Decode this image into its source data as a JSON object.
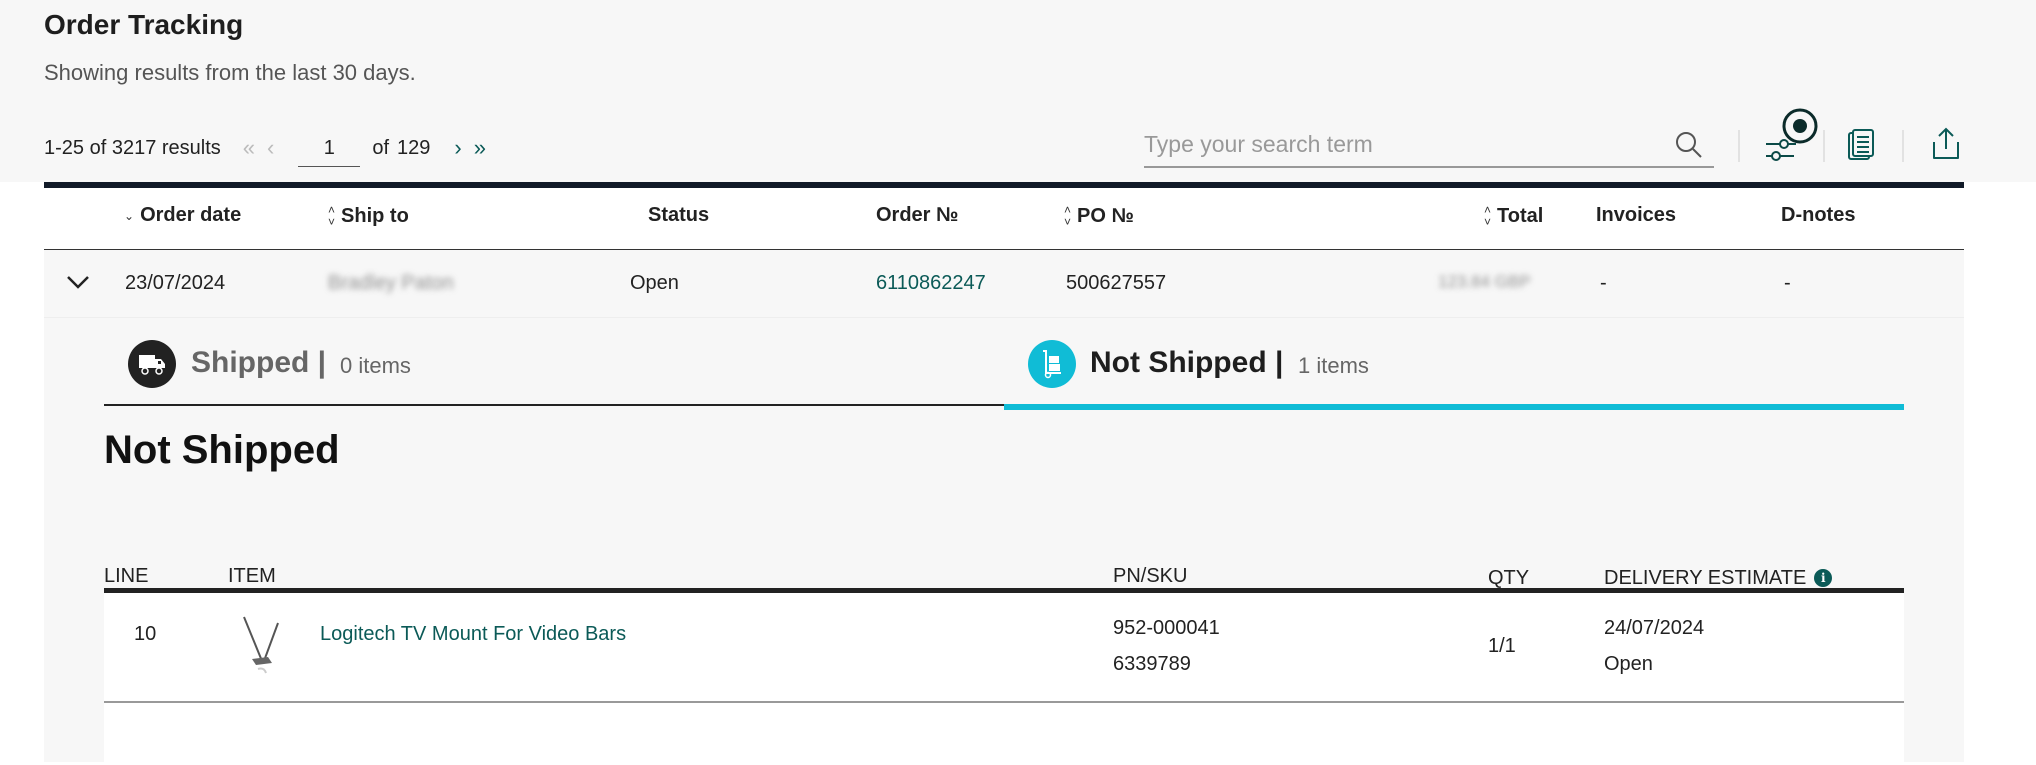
{
  "page": {
    "title": "Order Tracking",
    "subtitle": "Showing results from the last 30 days."
  },
  "pagination": {
    "results_text": "1-25 of 3217 results",
    "first_icon": "«",
    "prev_icon": "‹",
    "current_page": "1",
    "of_label": "of",
    "total_pages": "129",
    "next_icon": "›",
    "last_icon": "»"
  },
  "search": {
    "placeholder": "Type your search term",
    "value": ""
  },
  "toolbar": {
    "icons": [
      "search-icon",
      "filter-sliders-icon",
      "documents-icon",
      "share-export-icon"
    ]
  },
  "orders_table": {
    "columns": [
      {
        "label": "Order date",
        "sort": "desc"
      },
      {
        "label": "Ship to",
        "sort": "sortable"
      },
      {
        "label": "Status",
        "sort": "none"
      },
      {
        "label": "Order №",
        "sort": "none"
      },
      {
        "label": "PO №",
        "sort": "sortable"
      },
      {
        "label": "Total",
        "sort": "sortable"
      },
      {
        "label": "Invoices",
        "sort": "none"
      },
      {
        "label": "D-notes",
        "sort": "none"
      }
    ],
    "rows": [
      {
        "order_date": "23/07/2024",
        "ship_to": "Bradley Paton",
        "status": "Open",
        "order_no": "6110862247",
        "po_no": "500627557",
        "total": "123.84 GBP",
        "invoices": "-",
        "dnotes": "-",
        "expanded": true
      }
    ]
  },
  "order_detail": {
    "tabs": [
      {
        "label": "Shipped |",
        "count": "0 items",
        "icon": "truck-icon",
        "active": false
      },
      {
        "label": "Not Shipped |",
        "count": "1 items",
        "icon": "hand-truck-icon",
        "active": true
      }
    ],
    "section_heading": "Not Shipped",
    "items_columns": [
      "LINE",
      "ITEM",
      "PN/SKU",
      "QTY",
      "DELIVERY ESTIMATE"
    ],
    "items": [
      {
        "line": "10",
        "item_name": "Logitech TV Mount For Video Bars",
        "pn": "952-000041",
        "sku": "6339789",
        "qty": "1/1",
        "delivery_date": "24/07/2024",
        "delivery_status": "Open"
      }
    ]
  },
  "colors": {
    "accent_teal": "#0b5a57",
    "tab_active_cyan": "#10bcd6",
    "header_bar": "#111a28",
    "panel_bg": "#f7f7f7"
  }
}
